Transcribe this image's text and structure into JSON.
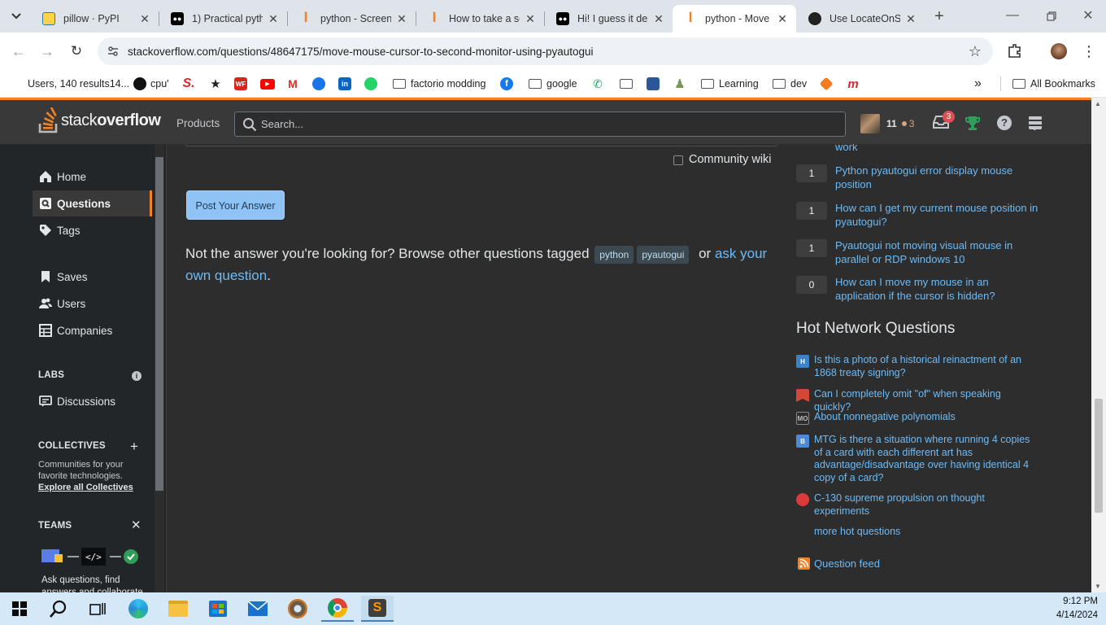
{
  "browser": {
    "tabs": [
      {
        "title": "pillow · PyPI",
        "active": false
      },
      {
        "title": "1) Practical pyth",
        "active": false
      },
      {
        "title": "python - Screen",
        "active": false
      },
      {
        "title": "How to take a sc",
        "active": false
      },
      {
        "title": "Hi! I guess it dep",
        "active": false
      },
      {
        "title": "python - Move m",
        "active": true
      },
      {
        "title": "Use LocateOnSc",
        "active": false
      }
    ],
    "url": "stackoverflow.com/questions/48647175/move-mouse-cursor-to-second-monitor-using-pyautogui",
    "bookmarks": [
      {
        "label": "Users, 140 results14..."
      },
      {
        "label": "cpu'"
      },
      {
        "label": "factorio modding"
      },
      {
        "label": "google"
      },
      {
        "label": "Learning"
      },
      {
        "label": "dev"
      }
    ],
    "more_bookmarks": "»",
    "all_bookmarks": "All Bookmarks"
  },
  "so_header": {
    "logo_light": "stack",
    "logo_bold": "overflow",
    "products": "Products",
    "search_placeholder": "Search...",
    "reputation": "11",
    "bronze_badges": "3",
    "inbox_count": "3"
  },
  "sidebar": {
    "home": "Home",
    "questions": "Questions",
    "tags": "Tags",
    "saves": "Saves",
    "users": "Users",
    "companies": "Companies",
    "labs_label": "LABS",
    "discussions": "Discussions",
    "collectives_label": "COLLECTIVES",
    "collectives_desc": "Communities for your favorite technologies.",
    "explore_collectives": "Explore all Collectives",
    "teams_label": "TEAMS",
    "teams_desc": "Ask questions, find answers and collaborate"
  },
  "main": {
    "community_wiki": "Community wiki",
    "post_answer": "Post Your Answer",
    "not_answer_prefix": "Not the answer you're looking for? Browse other questions tagged",
    "tags": [
      "python",
      "pyautogui"
    ],
    "or_text": "or",
    "ask_link": "ask your own question",
    "period": "."
  },
  "related": {
    "partial_top": "work",
    "items": [
      {
        "score": "1",
        "title": "Python pyautogui error display mouse position"
      },
      {
        "score": "1",
        "title": "How can I get my current mouse position in pyautogui?"
      },
      {
        "score": "1",
        "title": "Pyautogui not moving visual mouse in parallel or RDP windows 10"
      },
      {
        "score": "0",
        "title": "How can I move my mouse in an application if the cursor is hidden?"
      }
    ]
  },
  "hot_network": {
    "heading": "Hot Network Questions",
    "items": [
      {
        "title": "Is this a photo of a historical reinactment of an 1868 treaty signing?",
        "icon": "history-se-icon"
      },
      {
        "title": "Can I completely omit \"of\" when speaking quickly?",
        "icon": "english-se-icon"
      },
      {
        "title": "About nonnegative polynomials",
        "icon": "mathoverflow-icon"
      },
      {
        "title": "MTG is there a situation where running 4 copies of a card with each different art has advantage/disadvantage over having identical 4 copy of a card?",
        "icon": "boardgames-se-icon"
      },
      {
        "title": "C-130 supreme propulsion on thought experiments",
        "icon": "aviation-se-icon"
      }
    ],
    "more": "more hot questions"
  },
  "question_feed": "Question feed",
  "taskbar": {
    "time": "9:12 PM",
    "date": "4/14/2024"
  },
  "colors": {
    "accent_orange": "#f48225",
    "link_blue": "#6cbbf7",
    "button_blue": "#8fc3f5",
    "dark_bg": "#2d2d2d"
  }
}
